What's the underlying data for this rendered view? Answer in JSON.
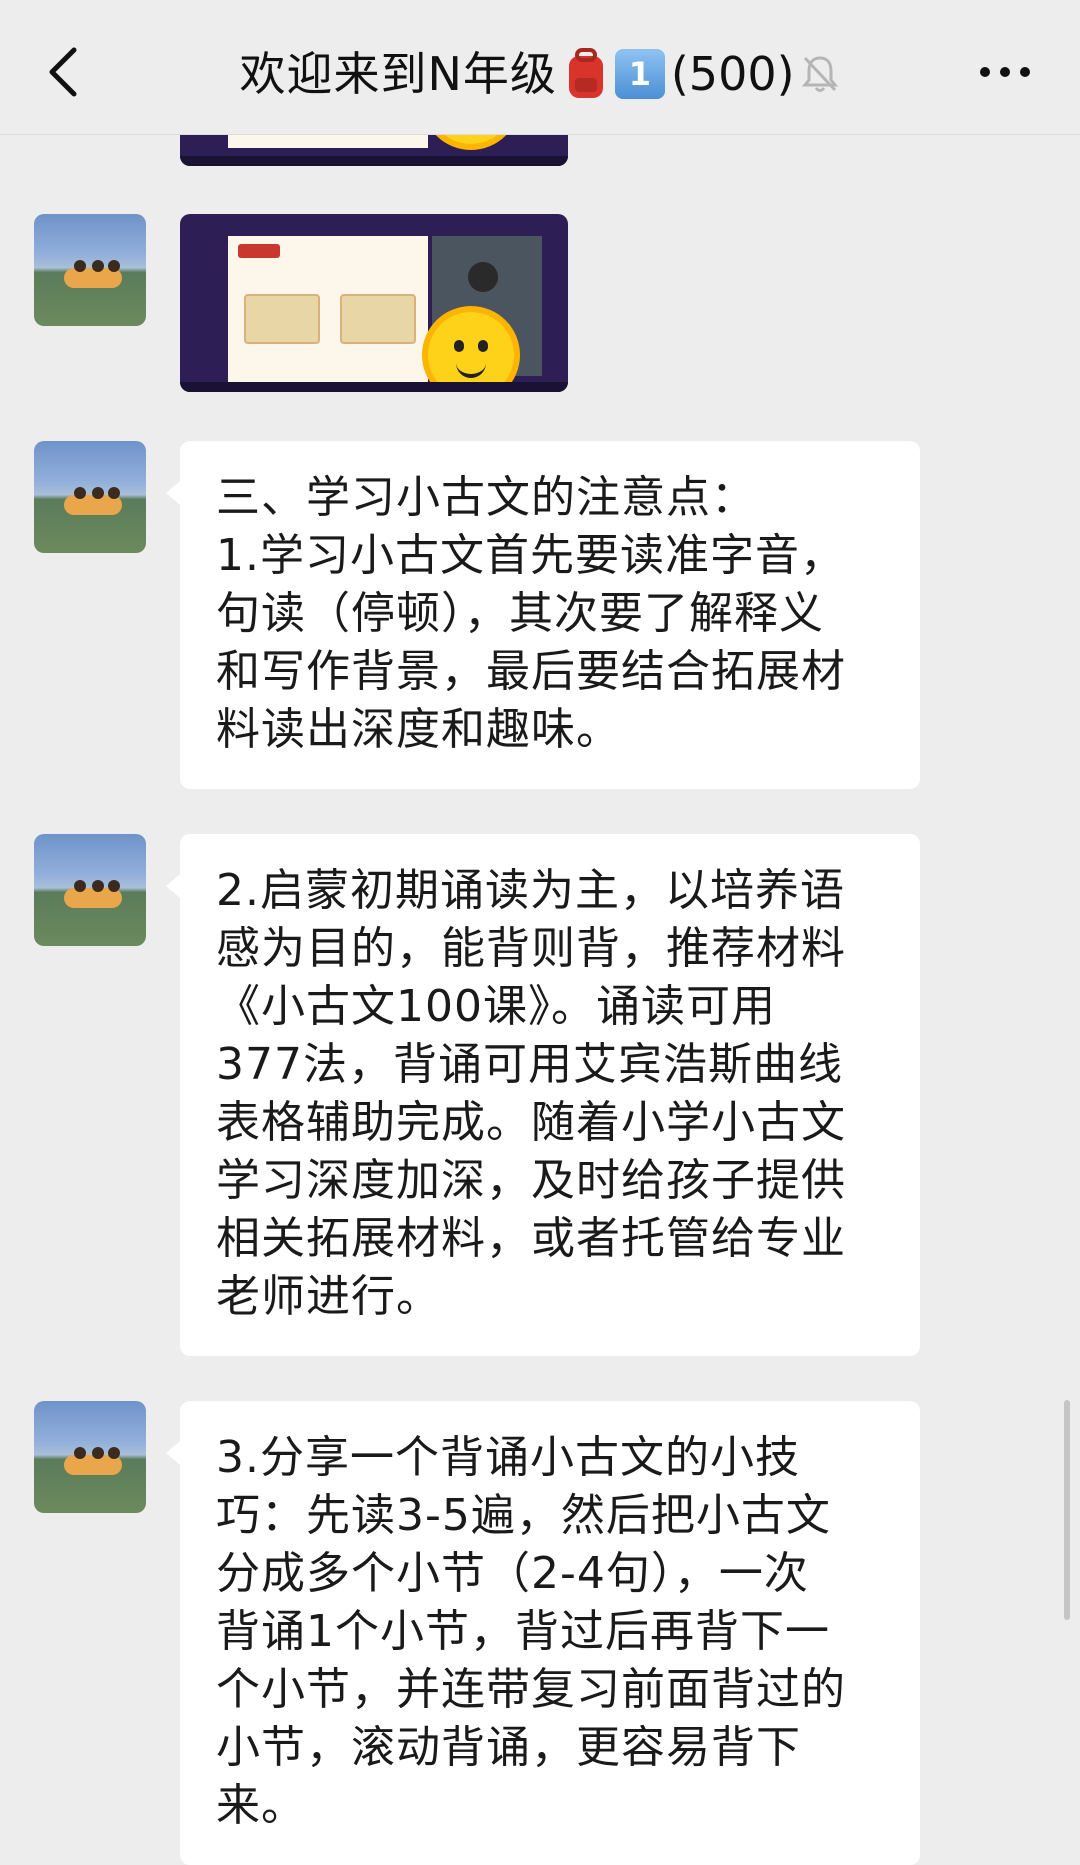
{
  "header": {
    "title": "欢迎来到N年级",
    "badge_emoji": "🎒",
    "key_emoji": "1",
    "member_count": "(500)",
    "icons": {
      "back": "chevron-left-icon",
      "mute": "bell-off-icon",
      "more": "more-dots-icon"
    }
  },
  "messages": [
    {
      "type": "video",
      "sender_avatar": "avatar-beach"
    },
    {
      "type": "video",
      "sender_avatar": "avatar-beach"
    },
    {
      "type": "text",
      "sender_avatar": "avatar-beach",
      "text": "三、学习小古文的注意点：\n1.学习小古文首先要读准字音，\n句读（停顿），其次要了解释义\n和写作背景，最后要结合拓展材\n料读出深度和趣味。"
    },
    {
      "type": "text",
      "sender_avatar": "avatar-beach",
      "text": "2.启蒙初期诵读为主，以培养语\n感为目的，能背则背，推荐材料\n《小古文100课》。诵读可用\n377法，背诵可用艾宾浩斯曲线\n表格辅助完成。随着小学小古文\n学习深度加深，及时给孩子提供\n相关拓展材料，或者托管给专业\n老师进行。"
    },
    {
      "type": "text",
      "sender_avatar": "avatar-beach",
      "text": "3.分享一个背诵小古文的小技\n巧：先读3-5遍，然后把小古文\n分成多个小节（2-4句），一次\n背诵1个小节，背过后再背下一\n个小节，并连带复习前面背过的\n小节，滚动背诵，更容易背下\n来。"
    }
  ],
  "colors": {
    "background": "#ededed",
    "bubble": "#ffffff",
    "text": "#1a1a1a"
  }
}
